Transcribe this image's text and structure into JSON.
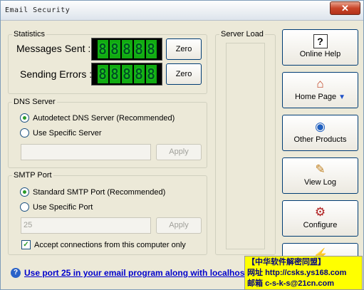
{
  "window": {
    "title": "Email Security",
    "close_glyph": "✕"
  },
  "statistics": {
    "legend": "Statistics",
    "messages_sent_label": "Messages Sent :",
    "sending_errors_label": "Sending Errors :",
    "messages_digits": "88888",
    "errors_digits": "88888",
    "zero_label_1": "Zero",
    "zero_label_2": "Zero"
  },
  "server_load": {
    "legend": "Server Load"
  },
  "dns": {
    "legend": "DNS Server",
    "option_auto": "Autodetect DNS Server (Recommended)",
    "option_specific": "Use Specific Server",
    "input_value": "",
    "apply_label": "Apply"
  },
  "smtp": {
    "legend": "SMTP Port",
    "option_standard": "Standard SMTP Port (Recommended)",
    "option_specific": "Use Specific Port",
    "input_value": "25",
    "apply_label": "Apply",
    "accept_label": "Accept connections from this computer only"
  },
  "side_buttons": [
    {
      "label": "Online Help",
      "icon": "help-icon"
    },
    {
      "label": "Home Page",
      "icon": "home-icon"
    },
    {
      "label": "Other Products",
      "icon": "products-icon"
    },
    {
      "label": "View Log",
      "icon": "log-icon"
    },
    {
      "label": "Configure",
      "icon": "configure-icon"
    }
  ],
  "footer": {
    "help_text": "Use port 25 in your email program along with localhost"
  },
  "watermark": {
    "line1": "【中华软件解密同盟】",
    "line2_label": "网址",
    "line2_value": "http://csks.ys168.com",
    "line3_label": "邮箱",
    "line3_value": "c-s-k-s@21cn.com"
  },
  "colors": {
    "accent": "#003c74",
    "lcd_green": "#11aa11",
    "link": "#0000cc",
    "watermark_bg": "#ffff00"
  }
}
